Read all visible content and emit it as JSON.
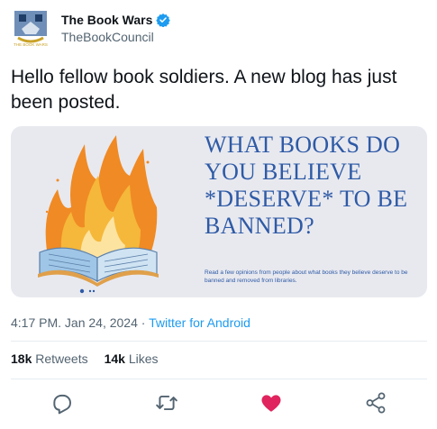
{
  "account": {
    "display_name": "The Book Wars",
    "handle": "TheBookCouncil",
    "avatar_text": "THE BOOK WARS",
    "verified": true,
    "verified_color": "#1d9bf0"
  },
  "tweet": {
    "text": "Hello fellow book soldiers. A new blog has just been posted."
  },
  "media": {
    "headline_lines": [
      "WHAT BOOKS DO",
      "YOU BELIEVE",
      "*DESERVE* TO BE",
      "BANNED?"
    ],
    "subtext": "Read a few opinions from people about what books they believe deserve to be banned and removed from libraries.",
    "headline_color": "#2e5aa6",
    "background_color": "#e8e9ef"
  },
  "meta": {
    "time": "4:17 PM",
    "date": "Jan 24, 2024",
    "separator": "·",
    "app": "Twitter for Android"
  },
  "stats": {
    "retweets_count": "18k",
    "retweets_label": "Retweets",
    "likes_count": "14k",
    "likes_label": "Likes"
  },
  "actions": {
    "icons": [
      "reply-icon",
      "retweet-icon",
      "like-icon",
      "share-icon"
    ],
    "like_color": "#e0245e",
    "icon_color": "#536471"
  }
}
